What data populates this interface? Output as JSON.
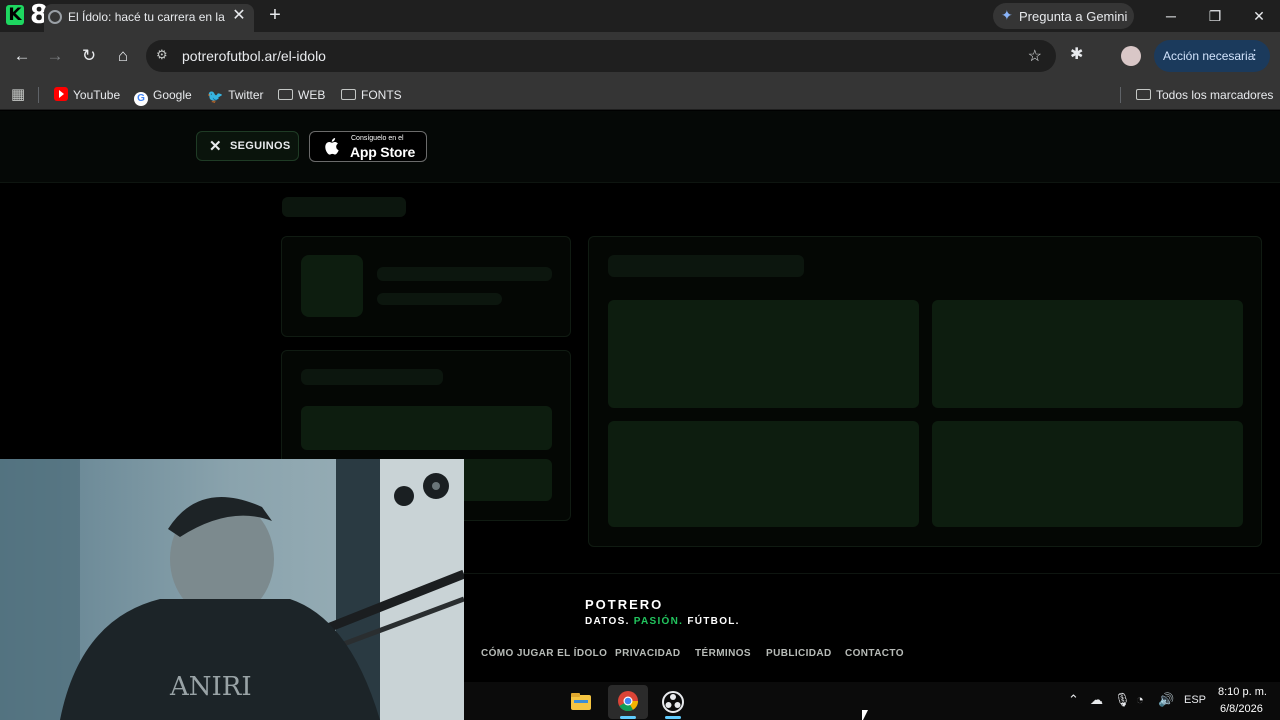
{
  "tabstrip": {
    "brand_number": "8",
    "tab_title": "El Ídolo: hacé tu carrera en la Li",
    "tab_close": "✕",
    "new_tab": "+",
    "gemini_label": "Pregunta a Gemini",
    "window_controls": {
      "minimize": "─",
      "restore": "❐",
      "close": "✕"
    }
  },
  "toolbar": {
    "back": "←",
    "forward": "→",
    "reload": "↻",
    "home": "⌂",
    "url": "potrerofutbol.ar/el-idolo",
    "bookmark_star": "☆",
    "action_label": "Acción necesaria",
    "action_menu": "⋮"
  },
  "bookmarks": {
    "items": [
      {
        "label": "YouTube",
        "icon": "youtube-icon"
      },
      {
        "label": "Google",
        "icon": "google-icon"
      },
      {
        "label": "Twitter",
        "icon": "twitter-icon"
      },
      {
        "label": "WEB",
        "icon": "folder-icon"
      },
      {
        "label": "FONTS",
        "icon": "folder-icon"
      }
    ],
    "all_bookmarks": "Todos los marcadores"
  },
  "page": {
    "follow_label": "SEGUINOS",
    "appstore_small": "Consíguelo en el",
    "appstore_big": "App Store",
    "footer": {
      "brand": "POTRERO",
      "tagline_1": "DATOS.",
      "tagline_2": "PASIÓN.",
      "tagline_3": "FÚTBOL.",
      "links": [
        "CÓMO JUGAR EL ÍDOLO",
        "PRIVACIDAD",
        "TÉRMINOS",
        "PUBLICIDAD",
        "CONTACTO"
      ],
      "accent_color": "#22c55e"
    }
  },
  "taskbar": {
    "apps": [
      "file-explorer-icon",
      "chrome-icon",
      "obs-icon"
    ],
    "tray_language": "ESP",
    "time": "8:10 p. m.",
    "date": "6/8/2026"
  }
}
